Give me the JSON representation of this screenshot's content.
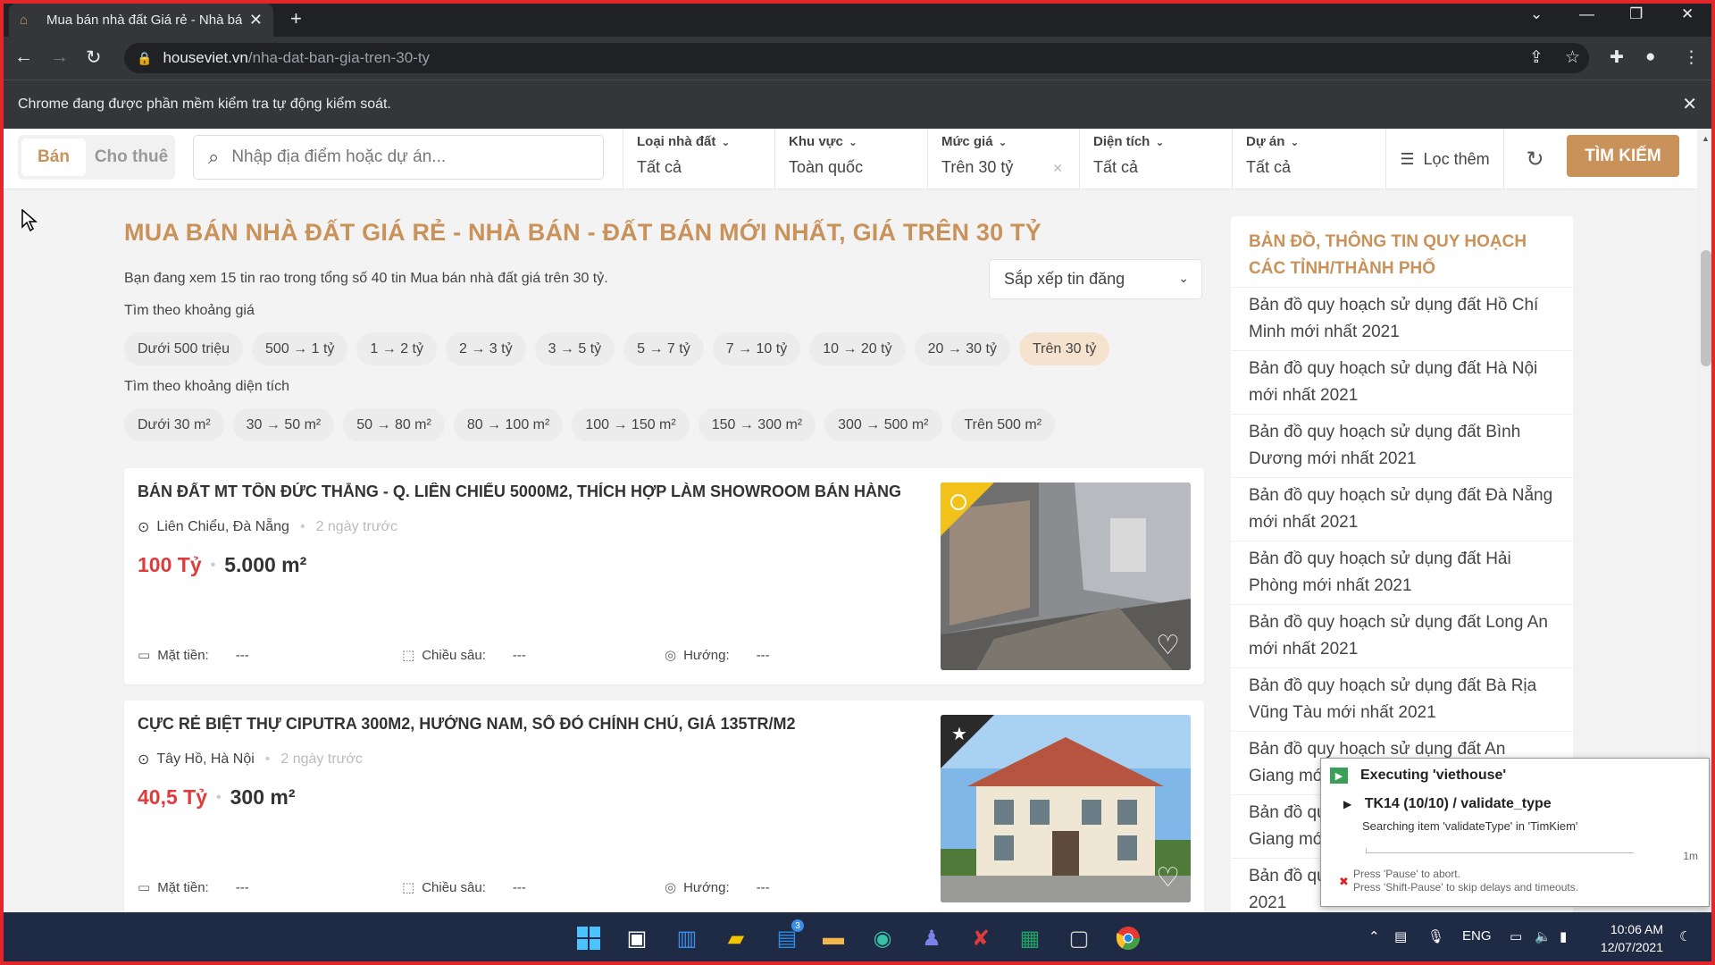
{
  "browser": {
    "tab_title": "Mua bán nhà đất Giá rẻ - Nhà bá",
    "url_host": "houseviet.vn",
    "url_path": "/nha-dat-ban-gia-tren-30-ty",
    "infobar_text": "Chrome đang được phần mềm kiểm tra tự động kiểm soát."
  },
  "header": {
    "mode_active": "Bán",
    "mode_inactive": "Cho thuê",
    "search_placeholder": "Nhập địa điểm hoặc dự án...",
    "filters": [
      {
        "label": "Loại nhà đất",
        "value": "Tất cả"
      },
      {
        "label": "Khu vực",
        "value": "Toàn quốc"
      },
      {
        "label": "Mức giá",
        "value": "Trên 30 tỷ"
      },
      {
        "label": "Diện tích",
        "value": "Tất cả"
      },
      {
        "label": "Dự án",
        "value": "Tất cả"
      }
    ],
    "more_filters": "Lọc thêm",
    "search_button": "TÌM KIẾM"
  },
  "main": {
    "title": "MUA BÁN NHÀ ĐẤT GIÁ RẺ - NHÀ BÁN - ĐẤT BÁN MỚI NHẤT, GIÁ TRÊN 30 TỶ",
    "summary": "Bạn đang xem 15 tin rao trong tổng số 40 tin Mua bán nhà đất giá trên 30 tỷ.",
    "sort_label": "Sắp xếp tin đăng",
    "price_label": "Tìm theo khoảng giá",
    "price_ranges": [
      "Dưới 500 triệu",
      "500 → 1 tỷ",
      "1 → 2 tỷ",
      "2 → 3 tỷ",
      "3 → 5 tỷ",
      "5 → 7 tỷ",
      "7 → 10 tỷ",
      "10 → 20 tỷ",
      "20 → 30 tỷ",
      "Trên 30 tỷ"
    ],
    "area_label": "Tìm theo khoảng diện tích",
    "area_ranges": [
      "Dưới 30 m²",
      "30 → 50 m²",
      "50 → 80 m²",
      "80 → 100 m²",
      "100 → 150 m²",
      "150 → 300 m²",
      "300 → 500 m²",
      "Trên 500 m²"
    ],
    "listings": [
      {
        "title": "BÁN ĐẤT MT TÔN ĐỨC THẮNG - Q. LIÊN CHIỂU 5000M2, THÍCH HỢP LÀM SHOWROOM BÁN HÀNG",
        "location": "Liên Chiểu, Đà Nẵng",
        "time": "2 ngày trước",
        "price": "100 Tỷ",
        "area": "5.000 m²",
        "frontage_label": "Mặt tiền:",
        "frontage": "---",
        "depth_label": "Chiều sâu:",
        "depth": "---",
        "direction_label": "Hướng:",
        "direction": "---"
      },
      {
        "title": "CỰC RẺ BIỆT THỰ CIPUTRA 300M2, HƯỚNG NAM, SỔ ĐỎ CHÍNH CHỦ, GIÁ 135TR/M2",
        "location": "Tây Hồ, Hà Nội",
        "time": "2 ngày trước",
        "price": "40,5 Tỷ",
        "area": "300 m²",
        "frontage_label": "Mặt tiền:",
        "frontage": "---",
        "depth_label": "Chiều sâu:",
        "depth": "---",
        "direction_label": "Hướng:",
        "direction": "---"
      }
    ]
  },
  "sidebar": {
    "title": "BẢN ĐỒ, THÔNG TIN QUY HOẠCH CÁC TỈNH/THÀNH PHỐ",
    "items": [
      "Bản đồ quy hoạch sử dụng đất Hồ Chí Minh mới nhất 2021",
      "Bản đồ quy hoạch sử dụng đất Hà Nội mới nhất 2021",
      "Bản đồ quy hoạch sử dụng đất Bình Dương mới nhất 2021",
      "Bản đồ quy hoạch sử dụng đất Đà Nẵng mới nhất 2021",
      "Bản đồ quy hoạch sử dụng đất Hải Phòng mới nhất 2021",
      "Bản đồ quy hoạch sử dụng đất Long An mới nhất 2021",
      "Bản đồ quy hoạch sử dụng đất Bà Rịa Vũng Tàu mới nhất 2021",
      "Bản đồ quy hoạch sử dụng đất An Giang mới nhất 2021",
      "Bản đồ quy hoạch sử dụng đất An Giang mới nhất 2021",
      "Bản đồ quy hoạch sử dụng đất mới nhất 2021"
    ]
  },
  "exec_dialog": {
    "title": "Executing 'viethouse'",
    "task": "TK14 (10/10) / validate_type",
    "message": "Searching item 'validateType' in 'TimKiem'",
    "time": "1m",
    "hint1": "Press 'Pause' to abort.",
    "hint2": "Press 'Shift-Pause' to skip delays and timeouts."
  },
  "taskbar": {
    "lang": "ENG",
    "time": "10:06 AM",
    "date": "12/07/2021",
    "badge_count": "3"
  },
  "colors": {
    "accent": "#c9925a",
    "price": "#e03b3b",
    "frame": "#e3262b"
  }
}
